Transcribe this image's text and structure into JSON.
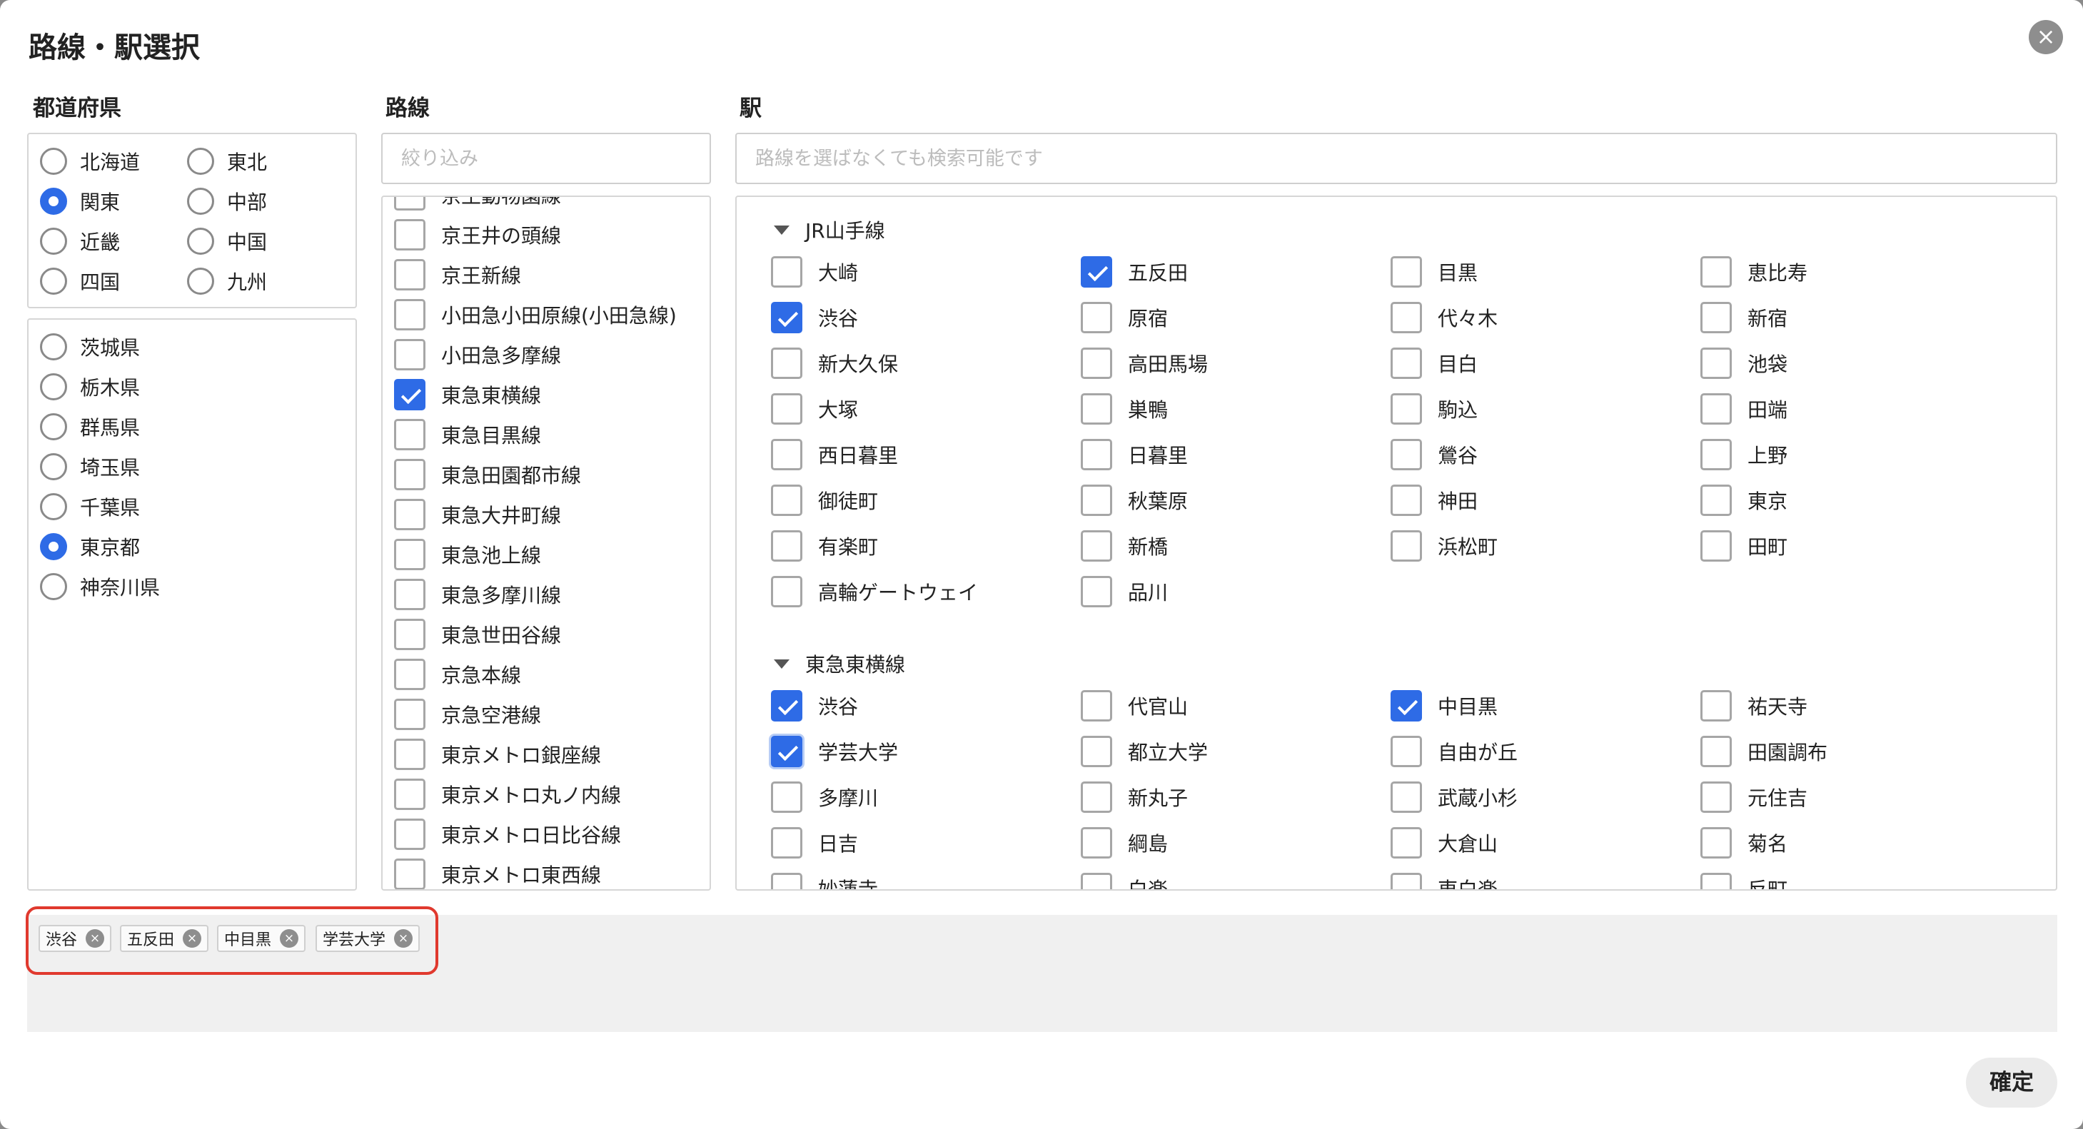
{
  "dialog": {
    "title": "路線・駅選択",
    "confirm_label": "確定"
  },
  "prefecture": {
    "heading": "都道府県",
    "regions": [
      {
        "label": "北海道",
        "selected": false
      },
      {
        "label": "東北",
        "selected": false
      },
      {
        "label": "関東",
        "selected": true
      },
      {
        "label": "中部",
        "selected": false
      },
      {
        "label": "近畿",
        "selected": false
      },
      {
        "label": "中国",
        "selected": false
      },
      {
        "label": "四国",
        "selected": false
      },
      {
        "label": "九州",
        "selected": false
      }
    ],
    "prefectures": [
      {
        "label": "茨城県",
        "selected": false
      },
      {
        "label": "栃木県",
        "selected": false
      },
      {
        "label": "群馬県",
        "selected": false
      },
      {
        "label": "埼玉県",
        "selected": false
      },
      {
        "label": "千葉県",
        "selected": false
      },
      {
        "label": "東京都",
        "selected": true
      },
      {
        "label": "神奈川県",
        "selected": false
      }
    ]
  },
  "lines": {
    "heading": "路線",
    "filter_placeholder": "絞り込み",
    "items": [
      {
        "label": "京王動物園線",
        "checked": false
      },
      {
        "label": "京王井の頭線",
        "checked": false
      },
      {
        "label": "京王新線",
        "checked": false
      },
      {
        "label": "小田急小田原線(小田急線)",
        "checked": false
      },
      {
        "label": "小田急多摩線",
        "checked": false
      },
      {
        "label": "東急東横線",
        "checked": true
      },
      {
        "label": "東急目黒線",
        "checked": false
      },
      {
        "label": "東急田園都市線",
        "checked": false
      },
      {
        "label": "東急大井町線",
        "checked": false
      },
      {
        "label": "東急池上線",
        "checked": false
      },
      {
        "label": "東急多摩川線",
        "checked": false
      },
      {
        "label": "東急世田谷線",
        "checked": false
      },
      {
        "label": "京急本線",
        "checked": false
      },
      {
        "label": "京急空港線",
        "checked": false
      },
      {
        "label": "東京メトロ銀座線",
        "checked": false
      },
      {
        "label": "東京メトロ丸ノ内線",
        "checked": false
      },
      {
        "label": "東京メトロ日比谷線",
        "checked": false
      },
      {
        "label": "東京メトロ東西線",
        "checked": false
      }
    ]
  },
  "stations": {
    "heading": "駅",
    "search_placeholder": "路線を選ばなくても検索可能です",
    "groups": [
      {
        "name": "JR山手線",
        "items": [
          {
            "label": "大崎",
            "checked": false
          },
          {
            "label": "五反田",
            "checked": true
          },
          {
            "label": "目黒",
            "checked": false
          },
          {
            "label": "恵比寿",
            "checked": false
          },
          {
            "label": "渋谷",
            "checked": true
          },
          {
            "label": "原宿",
            "checked": false
          },
          {
            "label": "代々木",
            "checked": false
          },
          {
            "label": "新宿",
            "checked": false
          },
          {
            "label": "新大久保",
            "checked": false
          },
          {
            "label": "高田馬場",
            "checked": false
          },
          {
            "label": "目白",
            "checked": false
          },
          {
            "label": "池袋",
            "checked": false
          },
          {
            "label": "大塚",
            "checked": false
          },
          {
            "label": "巣鴨",
            "checked": false
          },
          {
            "label": "駒込",
            "checked": false
          },
          {
            "label": "田端",
            "checked": false
          },
          {
            "label": "西日暮里",
            "checked": false
          },
          {
            "label": "日暮里",
            "checked": false
          },
          {
            "label": "鶯谷",
            "checked": false
          },
          {
            "label": "上野",
            "checked": false
          },
          {
            "label": "御徒町",
            "checked": false
          },
          {
            "label": "秋葉原",
            "checked": false
          },
          {
            "label": "神田",
            "checked": false
          },
          {
            "label": "東京",
            "checked": false
          },
          {
            "label": "有楽町",
            "checked": false
          },
          {
            "label": "新橋",
            "checked": false
          },
          {
            "label": "浜松町",
            "checked": false
          },
          {
            "label": "田町",
            "checked": false
          },
          {
            "label": "高輪ゲートウェイ",
            "checked": false
          },
          {
            "label": "品川",
            "checked": false
          }
        ]
      },
      {
        "name": "東急東横線",
        "items": [
          {
            "label": "渋谷",
            "checked": true
          },
          {
            "label": "代官山",
            "checked": false
          },
          {
            "label": "中目黒",
            "checked": true
          },
          {
            "label": "祐天寺",
            "checked": false
          },
          {
            "label": "学芸大学",
            "checked": true
          },
          {
            "label": "都立大学",
            "checked": false
          },
          {
            "label": "自由が丘",
            "checked": false
          },
          {
            "label": "田園調布",
            "checked": false
          },
          {
            "label": "多摩川",
            "checked": false
          },
          {
            "label": "新丸子",
            "checked": false
          },
          {
            "label": "武蔵小杉",
            "checked": false
          },
          {
            "label": "元住吉",
            "checked": false
          },
          {
            "label": "日吉",
            "checked": false
          },
          {
            "label": "綱島",
            "checked": false
          },
          {
            "label": "大倉山",
            "checked": false
          },
          {
            "label": "菊名",
            "checked": false
          },
          {
            "label": "妙蓮寺",
            "checked": false
          },
          {
            "label": "白楽",
            "checked": false
          },
          {
            "label": "東白楽",
            "checked": false
          },
          {
            "label": "反町",
            "checked": false
          }
        ]
      }
    ]
  },
  "selected_chips": [
    "渋谷",
    "五反田",
    "中目黒",
    "学芸大学"
  ],
  "colors": {
    "accent": "#2e6be6",
    "highlight": "#e0392e"
  }
}
